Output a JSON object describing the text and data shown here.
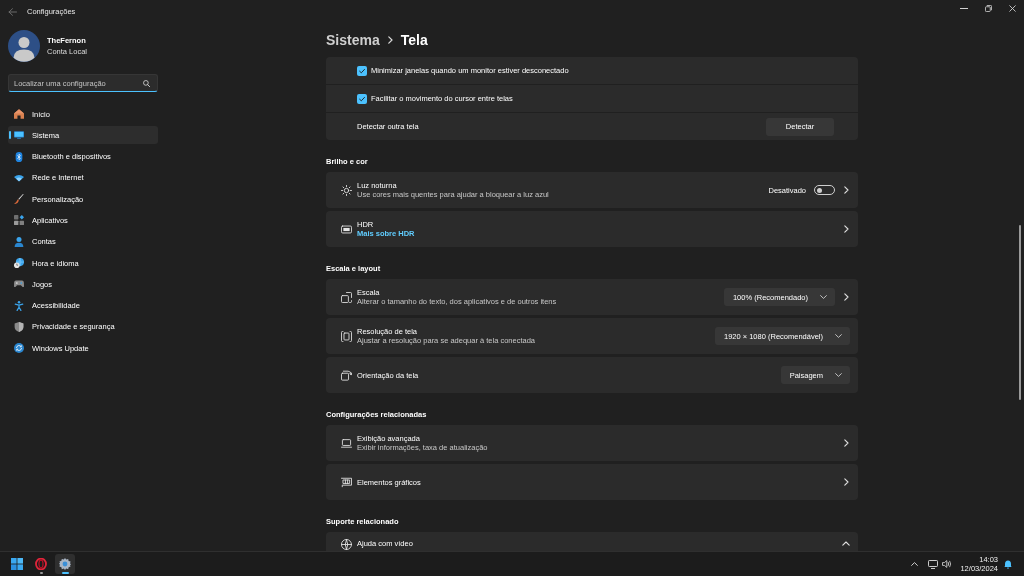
{
  "window": {
    "title": "Configurações"
  },
  "profile": {
    "name": "TheFernon",
    "account": "Conta Local"
  },
  "search": {
    "placeholder": "Localizar uma configuração"
  },
  "sidebar": {
    "items": [
      {
        "label": "Início",
        "selected": false
      },
      {
        "label": "Sistema",
        "selected": true
      },
      {
        "label": "Bluetooth e dispositivos",
        "selected": false
      },
      {
        "label": "Rede e Internet",
        "selected": false
      },
      {
        "label": "Personalização",
        "selected": false
      },
      {
        "label": "Aplicativos",
        "selected": false
      },
      {
        "label": "Contas",
        "selected": false
      },
      {
        "label": "Hora e idioma",
        "selected": false
      },
      {
        "label": "Jogos",
        "selected": false
      },
      {
        "label": "Acessibilidade",
        "selected": false
      },
      {
        "label": "Privacidade e segurança",
        "selected": false
      },
      {
        "label": "Windows Update",
        "selected": false
      }
    ]
  },
  "breadcrumb": {
    "parent": "Sistema",
    "current": "Tela"
  },
  "sections": [
    {
      "cards": [
        {
          "kind": "group",
          "rows": [
            {
              "kind": "checkbox",
              "label": "Minimizar janelas quando um monitor estiver desconectado",
              "checked": true
            },
            {
              "kind": "checkbox",
              "label": "Facilitar o movimento do cursor entre telas",
              "checked": true
            },
            {
              "kind": "button",
              "label": "Detectar outra tela",
              "button": "Detectar"
            }
          ]
        }
      ]
    },
    {
      "heading": "Brilho e cor",
      "cards": [
        {
          "kind": "toggle",
          "title": "Luz noturna",
          "subtitle": "Use cores mais quentes para ajudar a bloquear a luz azul",
          "status": "Desativado",
          "on": false
        },
        {
          "kind": "link",
          "title": "HDR",
          "link": "Mais sobre HDR"
        }
      ]
    },
    {
      "heading": "Escala e layout",
      "cards": [
        {
          "kind": "dropdown",
          "title": "Escala",
          "subtitle": "Alterar o tamanho do texto, dos aplicativos e de outros itens",
          "value": "100% (Recomendado)",
          "opens_page": true
        },
        {
          "kind": "dropdown",
          "title": "Resolução de tela",
          "subtitle": "Ajustar a resolução para se adequar à tela conectada",
          "value": "1920 × 1080 (Recomendável)",
          "opens_page": false
        },
        {
          "kind": "dropdown",
          "title": "Orientação da tela",
          "value": "Paisagem",
          "opens_page": false
        }
      ]
    },
    {
      "heading": "Configurações relacionadas",
      "cards": [
        {
          "kind": "nav",
          "title": "Exibição avançada",
          "subtitle": "Exibir informações, taxa de atualização"
        },
        {
          "kind": "nav",
          "title": "Elementos gráficos"
        }
      ]
    },
    {
      "heading": "Suporte relacionado",
      "cards": [
        {
          "kind": "expander",
          "title": "Ajuda com vídeo",
          "expanded": true
        }
      ]
    }
  ],
  "taskbar": {
    "apps": [
      {
        "selected": false,
        "running": true
      },
      {
        "selected": true,
        "running": true
      }
    ],
    "time": "14:03",
    "date": "12/03/2024"
  }
}
